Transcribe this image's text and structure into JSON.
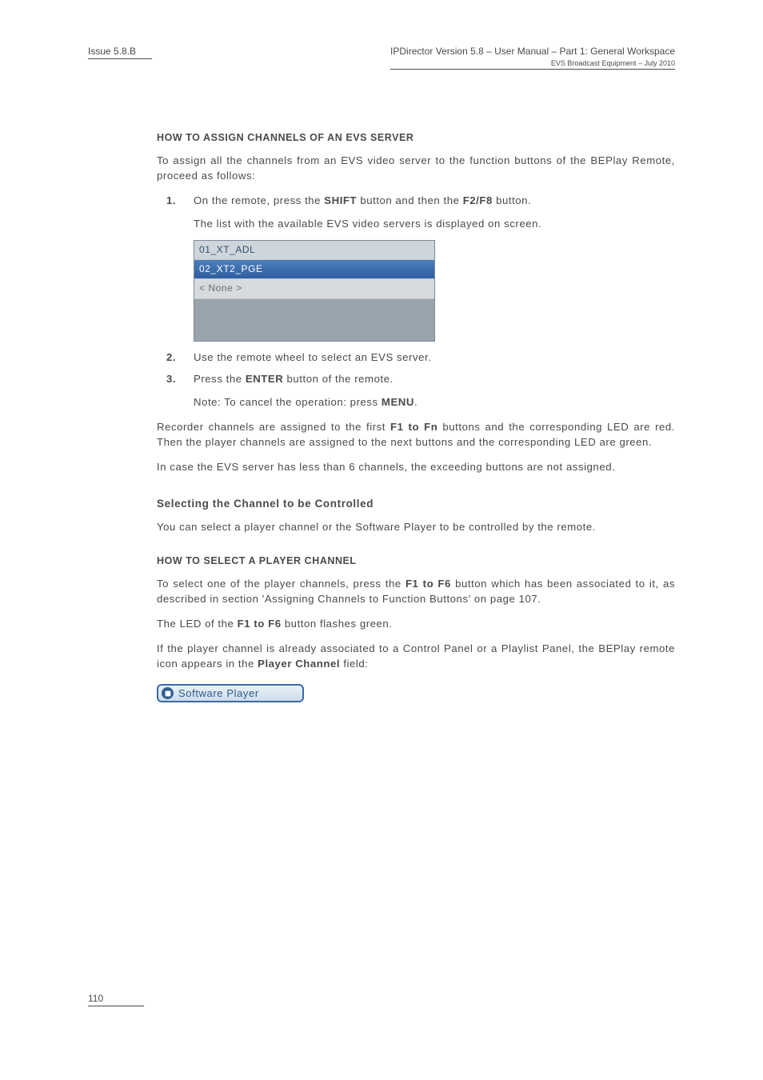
{
  "header": {
    "issue": "Issue 5.8.B",
    "title_line1": "IPDirector Version 5.8 – User Manual – Part 1: General Workspace",
    "title_line2": "EVS Broadcast Equipment  – July 2010"
  },
  "section_how_to_assign": {
    "title": "HOW TO ASSIGN CHANNELS OF AN EVS SERVER",
    "p1": "To assign all the channels from an EVS video server to the function buttons of the BEPlay Remote, proceed as follows:",
    "step1": {
      "num": "1.",
      "prefix": "On the remote, press the ",
      "btn1": "SHIFT",
      "mid": " button and then the ",
      "btn2": "F2/F8",
      "suffix": " button."
    },
    "step1_followup": "The list with the available EVS video servers is displayed on screen.",
    "listbox": {
      "row1": "01_XT_ADL",
      "row2": "02_XT2_PGE",
      "row3": "< None >"
    },
    "step2": {
      "num": "2.",
      "text": "Use the remote wheel to select an EVS server."
    },
    "step3": {
      "num": "3.",
      "prefix": "Press the ",
      "btn": "ENTER",
      "suffix": " button of the remote."
    },
    "note": {
      "prefix": "Note: To cancel the operation: press ",
      "btn": "MENU",
      "suffix": "."
    },
    "p2a": "Recorder channels are assigned to the first ",
    "p2b": "F1 to Fn",
    "p2c": " buttons and the corresponding LED are red. Then the player channels are assigned to the next buttons and the corresponding LED are green.",
    "p3": "In case the EVS server has less than 6 channels, the exceeding buttons are not assigned."
  },
  "section_selecting": {
    "title": "Selecting the Channel to be Controlled",
    "p1": "You can select a player channel or the Software Player to be controlled by the remote."
  },
  "section_select_player": {
    "title": "HOW TO SELECT A PLAYER CHANNEL",
    "p1a": "To select one of the player channels, press the ",
    "p1b": "F1 to F6",
    "p1c": " button which has been associated to it, as described in section 'Assigning Channels to Function Buttons' on page 107.",
    "p2a": "The LED of the ",
    "p2b": "F1 to F6 ",
    "p2c": "button flashes green.",
    "p3a": "If the player channel is already associated to a Control Panel or a Playlist Panel, the BEPlay remote icon appears in the ",
    "p3b": "Player Channel ",
    "p3c": "field:",
    "player_label": "Software Player"
  },
  "footer": {
    "page_number": "110"
  }
}
